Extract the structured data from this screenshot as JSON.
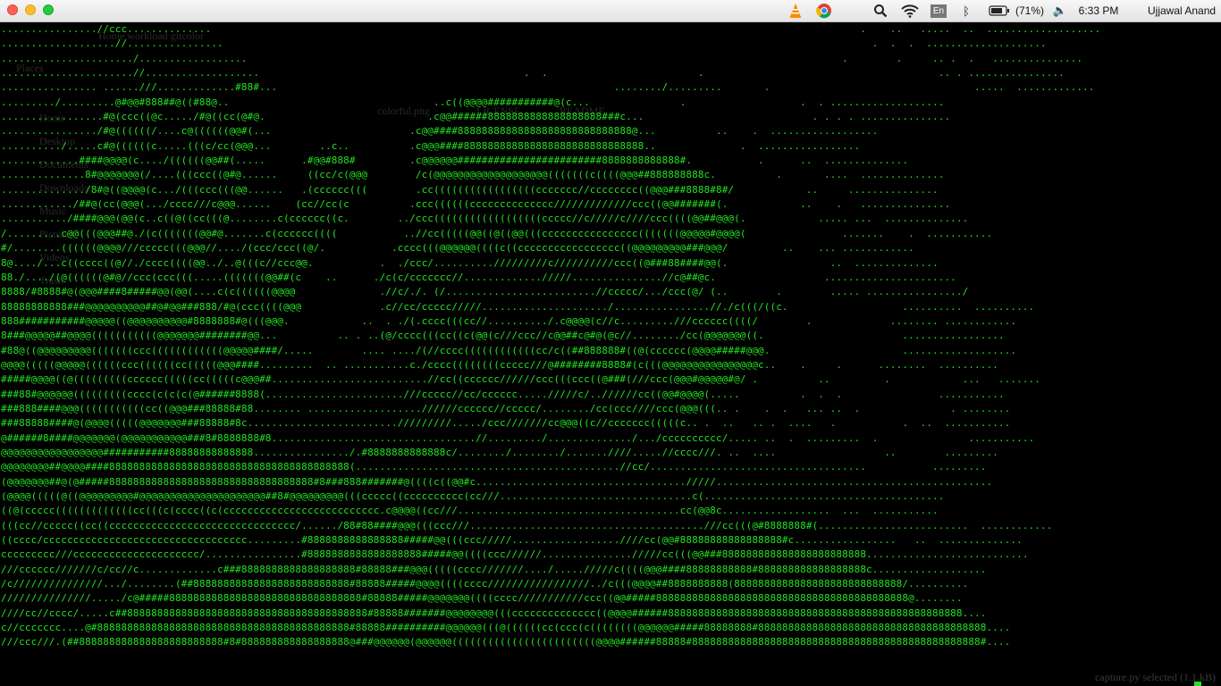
{
  "menubar": {
    "language_badge": "En",
    "battery_percent": "(71%)",
    "time": "6:33 PM",
    "user_name": "Ujjawal Anand"
  },
  "background_window": {
    "breadcrumb": "Home  workload  gitcolor",
    "sidebar_items": [
      "Places",
      "Home",
      "Desktop",
      "Documents",
      "Downloads",
      "Music",
      "Pictures",
      "Videos",
      "Trash"
    ],
    "files": [
      "colorful.png",
      "LICENSE",
      "README"
    ],
    "status": "capture.py  selected  (1.1 kB)"
  },
  "terminal": {
    "lines": [
      "................//ccc..............                                                                                                            .    ..   .....  ..  ...................",
      "...................//................                                                                                                            .  .  .  ....................",
      "....................../..................                                                                                                   .        .     .. .  .   ...............",
      "......................//...................                                            .  .                         .                                       .. . ................",
      "................ ......///.............#88#...                                                        ......../.........       .                                  .....  .............",
      "........./.........@#@@#888##@((#88@..                                  ..c((@@@@###########@(c...               .                   .  . ...................",
      ".................#@(ccc((@c...../#@((cc(@#@.                           .c@@######8888888888888888888###c...                            . . . . ...............",
      "................/#@((((((/....c@((((((@@#(...                       .c@@####88888888888888888888888888888@...          ..    .  ..................",
      "........../.....c#@((((((c.....(((c/cc(@@@...        ..c..          .c@@@####888888888888888888888888888888..              .  .................",
      ".............####@@@@(c..../((((((@@##(.....      .#@@#888#         .c@@@@@@########################8888888888888#.           .      ..  ..............",
      "..............8#@@@@@@@(/....(((ccc((@#@......     ((cc/c(@@@        /c(@@@@@@@@@@@@@@@@@@@(((((((c((((@@@##888888888c.          .       ....  ..............",
      "............../8#@((@@@@(c.../(((ccc(((@@......   .(cccccc(((        .cc(((((((((((((((((ccccccc//cccccccc((@@@###8888#8#/            ..     ...............",
      "............/##@(cc(@@@(.../cccc///c@@@......    (cc//cc(c          .ccc((((((cccccccccccccc/////////////ccc((@@#######(.            ..    .   ...............",
      ".........../####@@@(@@(c..c((@((cc(((@........c(cccccc((c.        ../ccc((((((((((((((((((ccccc//c/////c////ccc((((@@##@@@(.            ..... ...  ..............",
      "/.........c@@(((@@@##@./(c(((((((@@#@.......c(cccccc((((           ..//cc(((((@@((@((@@(((cccccccccccccccc(((((((@@@@@#@@@@(                .......    .  ...........",
      "#/........((((((@@@@///ccccc(((@@@//..../(ccc/ccc((@/.           .cccc(((@@@@@@((((c((ccccccccccccccccc((@@@@@@@@@###@@@/         ..    ... ............",
      "8@..../...c((cccc((@//./cccc((((@@../..@(((c//ccc@@.           .  ./ccc/........../////////c//////////ccc((@###88####@@(.                 ..  ..............",
      "88./..../(@((((((@#@//ccc(ccc(((.....(((((((@@##(c    ..      ./c(c/ccccccc//............./////...............//c@##@c.                  ......................",
      "8888/#8888#@(@@@####8#####@@(@@(....c(c((((((@@@@              .//c/./. (/.........................//ccccc/.../ccc(@/ (..        .        ..... ................/",
      "88888888888###@@@@@@@@@@##@#@@###888/#@(ccc((((@@@             .c//cc/ccccc/////...................../................//./c(((/((c.                   ..........  ..........",
      "888###########@@@@@((@@@@@@@@@@#8888888#@(((@@@.            ..  . ./(.cccc(((cc//........../.c@@@@(c//c.........///cccccc((((/        .             ........ ............",
      "8###@@@@@##@@@@(((((((((((@@@@@@@########@@...          .. . ..(@/cccc(((cc((c(@@(c///ccc//c@@##c@#@(@c//......../cc(@@@@@@@((.                       .................",
      "#88@((@@@@@@@@@(((((((ccc((((((((((((@@@@@####/.....        .... ..../(//cccc((((((((((((cc/c((##888888#((@(cccccc(@@@@#####@@@.                      ...................",
      "@@@@(((((@@@@@((((((ccc((((((cc(((((@@@####.........  .. ...........c./cccc((((((((ccccc///@########8888#(c(((@@@@@@@@@@@@@@@@c..    .     .      ........  ..........",
      "#####@@@@((@(((((((((cccccc(((((cc(((((c@@@##..........................//cc((cccccc//////ccc(((ccc((@###(///ccc(@@@#@@@@@#@/ .          ..         .            ...   .......",
      "###88#@@@@@@(((((((((cccc(c(c(c(@######8888(.......................///ccccc//cc/cccccc...../////c/..//////cc((@@#@@@@(.....          .  .  .                ...........",
      "###888####@@@(((((((((((cc((@@@###88888#88........ ...................//////cccccc//ccccc/......../cc(ccc////ccc(@@@(((.. .    .  .   ... ..  .               . ........",
      "###88888####@(@@@@(((((@@@@@@@###88888#8c........................./////////...../ccc///////cc@@@((c//ccccccc(((((c.. .  ..   .. .  ....   .           .  ..  ...........",
      "@######8####@@@@@@@(@@@@@@@@@@@###8#8888888#8..................................//........./............../.../cccccccccc/..... ..  .  .........  .               ...........",
      "@@@@@@@@@@@@@@@@@###########88888888888888................/.#8888888888888c/......../......../.......////.....//cccc///. ..  ....                  ..        .........",
      "@@@@@@@@##@@@@####8888888888888888888888888888888888888888(............................................//cc/....................................           .........",
      "(@@@@@@@##@(@#####8888888888888888888888888888888888#8###888#######@((((c((@@#c.................................../////..............................................",
      "(@@@@(((((@((@@@@@@@@@#@@@@@@@@@@@@@@@@@@@@@##8#@@@@@@@@@(((ccccc((cccccccccc(cc///................................c(........................................",
      "((@(ccccc(((((((((((((cc(((c(cccc((c(cccccccccccccccccccccccccc.c@@@@((cc///.....................................cc(@@8c..................  ...  ...........",
      "(((cc//ccccc((cc((ccccccccccccccccccccccccccccccc/....../88#88####@@@(((ccc///.......................................///cc(((@#8888888#(.........................  ............",
      "((cccc/cccccccccccccccccccccccccccccccccc.........#8888888888888888#####@@(((ccc/////..................////cc(@@#88888888888888888#c.................   ..  ..............",
      "ccccccccc///ccccccccccccccccccccc/................#8888888888888888888#####@@((((ccc//////.............../////cc(((@@###888888888888888888888888...........................",
      "///cccccc///////c/cc//c.............c###8888888888888888888#88888###@@@(((((cccc///////..../...../////c((((@@@####88888888888#888888888888888888c...................",
      "/c///////////////.../........(##88888888888888888888888888#88888#####@@@@((((cccc/////////////////../c(((@@@@##8888888888(8888888888888888888888888888/..........",
      "///////////////...../c@#####88888888888888888888888888888888#88888#####@@@@@@@((((cccc///////////ccc((@@#####888888888888888888888888888888888888888888@........",
      "////cc//cccc/.....c##8888888888888888888888888888888888888888#88888#######@@@@@@@@(((cccccccccccccc((@@@@######8888888888888888888888888888888888888888888888888....",
      "c//ccccccc....@#888888888888888888888888888888888888888888#88888##########@@@@@@(((@((((((cc(ccc(c((((((((@@@@@@#####88888888#88888888888888888888888888888888888888....",
      "///ccc///.(##888888888888888888888888#8#888888888888888888@###@@@@@@(@@@@@@((((((((((((((((((((((((@@@@######88888#888888888888888888888888888888888888888888888888#...."
    ]
  }
}
